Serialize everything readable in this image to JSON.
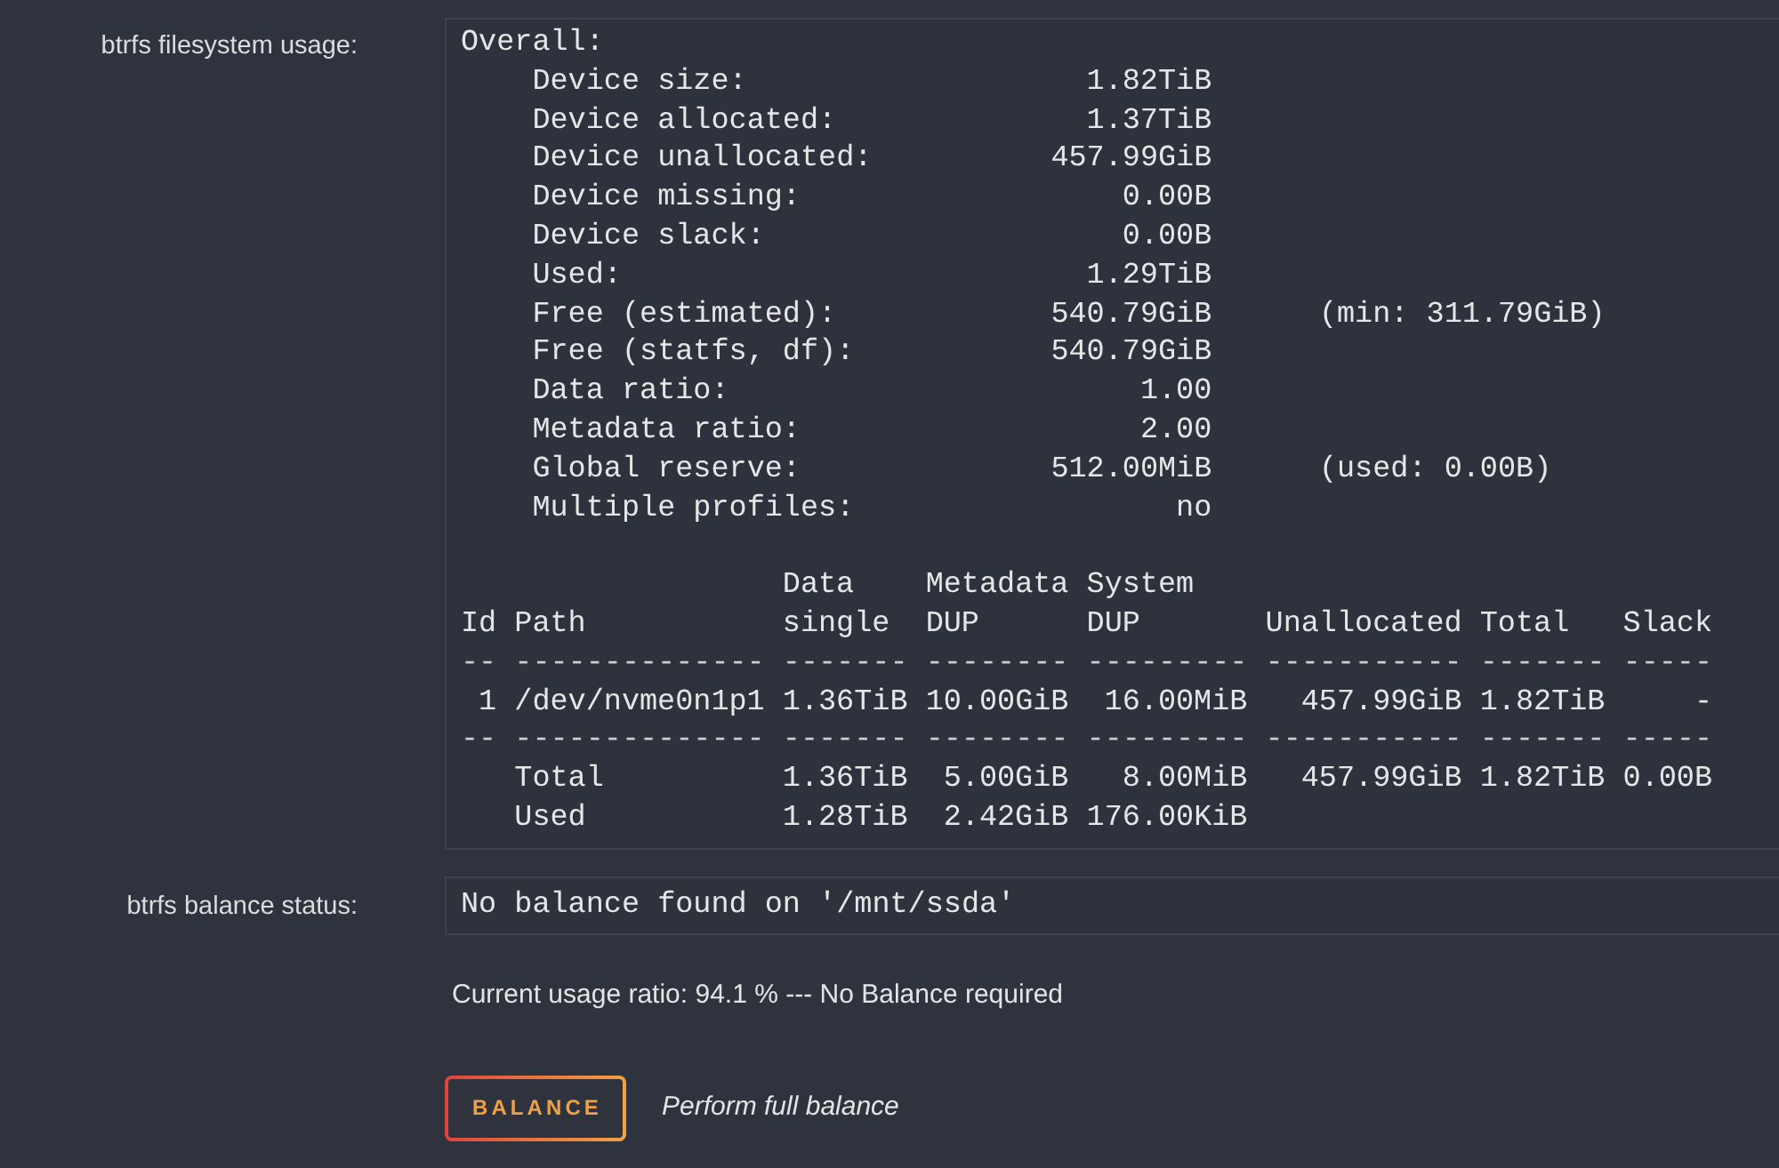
{
  "filesystem_usage": {
    "label": "btrfs filesystem usage:",
    "overall": {
      "heading": "Overall:",
      "items": [
        {
          "label": "Device size:",
          "value": "1.82TiB"
        },
        {
          "label": "Device allocated:",
          "value": "1.37TiB"
        },
        {
          "label": "Device unallocated:",
          "value": "457.99GiB"
        },
        {
          "label": "Device missing:",
          "value": "0.00B"
        },
        {
          "label": "Device slack:",
          "value": "0.00B"
        },
        {
          "label": "Used:",
          "value": "1.29TiB"
        },
        {
          "label": "Free (estimated):",
          "value": "540.79GiB",
          "note": "(min: 311.79GiB)"
        },
        {
          "label": "Free (statfs, df):",
          "value": "540.79GiB"
        },
        {
          "label": "Data ratio:",
          "value": "1.00"
        },
        {
          "label": "Metadata ratio:",
          "value": "2.00"
        },
        {
          "label": "Global reserve:",
          "value": "512.00MiB",
          "note": "(used: 0.00B)"
        },
        {
          "label": "Multiple profiles:",
          "value": "no"
        }
      ]
    },
    "device_table": {
      "columns": [
        {
          "label": "Id"
        },
        {
          "label": "Path"
        },
        {
          "top": "Data",
          "label": "single"
        },
        {
          "top": "Metadata",
          "label": "DUP"
        },
        {
          "top": "System",
          "label": "DUP"
        },
        {
          "label": "Unallocated"
        },
        {
          "label": "Total"
        },
        {
          "label": "Slack"
        }
      ],
      "rows": [
        {
          "kind": "rule",
          "cells": [
            "--",
            "--------------",
            "-------",
            "--------",
            "---------",
            "-----------",
            "-------",
            "-----"
          ]
        },
        {
          "kind": "device",
          "id": "1",
          "path": "/dev/nvme0n1p1",
          "values": [
            "1.36TiB",
            "10.00GiB",
            "16.00MiB",
            "457.99GiB",
            "1.82TiB",
            "-"
          ]
        },
        {
          "kind": "rule",
          "cells": [
            "--",
            "--------------",
            "-------",
            "--------",
            "---------",
            "-----------",
            "-------",
            "-----"
          ]
        },
        {
          "kind": "summary",
          "label": "Total",
          "values": [
            "1.36TiB",
            "5.00GiB",
            "8.00MiB",
            "457.99GiB",
            "1.82TiB",
            "0.00B"
          ]
        },
        {
          "kind": "summary",
          "label": "Used",
          "values": [
            "1.28TiB",
            "2.42GiB",
            "176.00KiB"
          ]
        }
      ]
    }
  },
  "balance": {
    "label": "btrfs balance status:",
    "status": "No balance found on '/mnt/ssda'",
    "message": "Current usage ratio: 94.1 % --- No Balance required",
    "button": "BALANCE",
    "button_hint": "Perform full balance"
  }
}
